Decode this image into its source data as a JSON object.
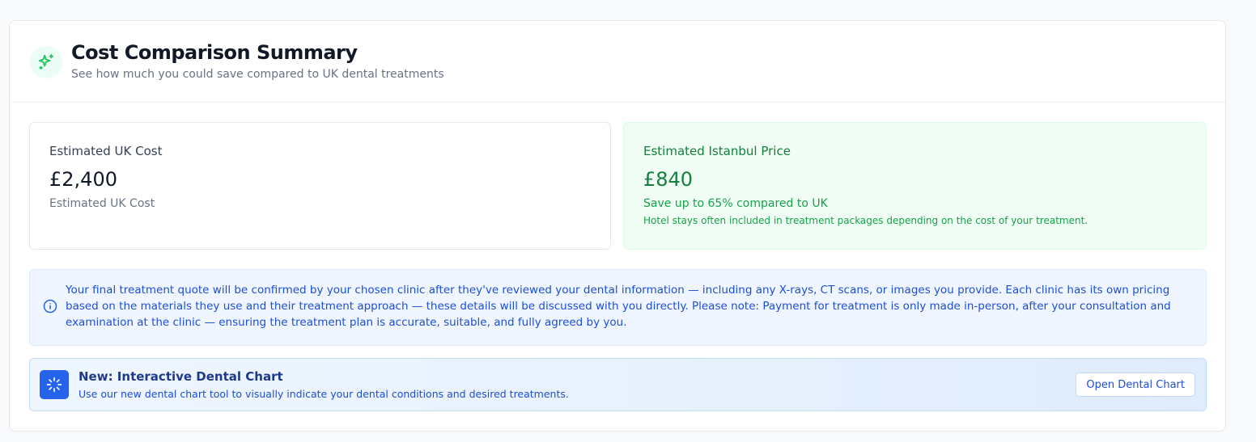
{
  "header": {
    "title": "Cost Comparison Summary",
    "subtitle": "See how much you could save compared to UK dental treatments",
    "icon": "sparkles-icon"
  },
  "uk": {
    "label": "Estimated UK Cost",
    "value": "£2,400",
    "note": "Estimated UK Cost"
  },
  "istanbul": {
    "label": "Estimated Istanbul Price",
    "value": "£840",
    "savings": "Save up to 65% compared to UK",
    "hotel_note": "Hotel stays often included in treatment packages depending on the cost of your treatment."
  },
  "info": {
    "icon": "info-icon",
    "text": "Your final treatment quote will be confirmed by your chosen clinic after they've reviewed your dental information — including any X-rays, CT scans, or images you provide. Each clinic has its own pricing based on the materials they use and their treatment approach — these details will be discussed with you directly. Please note: Payment for treatment is only made in-person, after your consultation and examination at the clinic — ensuring the treatment plan is accurate, suitable, and fully agreed by you."
  },
  "dental_chart": {
    "icon": "loader-icon",
    "title": "New: Interactive Dental Chart",
    "description": "Use our new dental chart tool to visually indicate your dental conditions and desired treatments.",
    "button_label": "Open Dental Chart"
  },
  "colors": {
    "accent_green": "#15803d",
    "accent_blue": "#2563eb",
    "info_bg": "#eff6ff"
  }
}
